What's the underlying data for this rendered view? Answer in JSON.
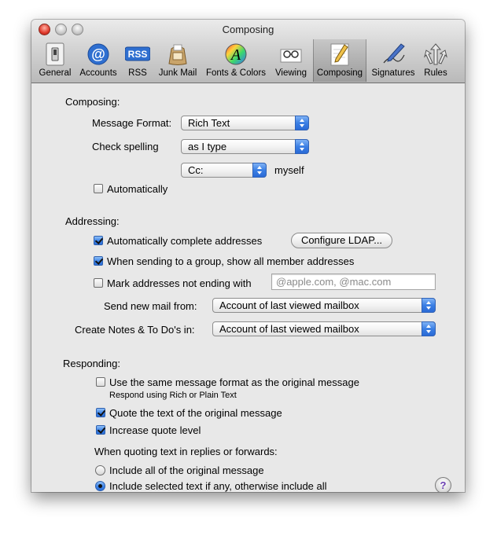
{
  "window": {
    "title": "Composing"
  },
  "toolbar": {
    "items": [
      {
        "label": "General",
        "icon": "general-switch-icon"
      },
      {
        "label": "Accounts",
        "icon": "at-sign-icon"
      },
      {
        "label": "RSS",
        "icon": "rss-icon",
        "badge": "RSS"
      },
      {
        "label": "Junk Mail",
        "icon": "junk-mail-bag-icon"
      },
      {
        "label": "Fonts & Colors",
        "icon": "fonts-colors-icon",
        "glyph": "A"
      },
      {
        "label": "Viewing",
        "icon": "viewing-glasses-icon"
      },
      {
        "label": "Composing",
        "icon": "composing-pencil-icon",
        "active": true
      },
      {
        "label": "Signatures",
        "icon": "signatures-pen-icon"
      },
      {
        "label": "Rules",
        "icon": "rules-arrows-icon"
      }
    ],
    "active_color": "#3c82e6"
  },
  "composing": {
    "heading": "Composing:",
    "message_format_label": "Message Format:",
    "message_format_value": "Rich Text",
    "check_spelling_label": "Check spelling",
    "check_spelling_value": "as I type",
    "automatically_label": "Automatically",
    "automatically_checked": false,
    "cc_value": "Cc:",
    "myself_label": "myself"
  },
  "addressing": {
    "heading": "Addressing:",
    "auto_complete_label": "Automatically complete addresses",
    "auto_complete_checked": true,
    "configure_ldap_label": "Configure LDAP...",
    "group_label": "When sending to a group, show all member addresses",
    "group_checked": true,
    "mark_addresses_label": "Mark addresses not ending with",
    "mark_addresses_checked": false,
    "mark_addresses_placeholder": "@apple.com, @mac.com",
    "send_from_label": "Send new mail from:",
    "send_from_value": "Account of last viewed mailbox",
    "notes_label": "Create Notes & To Do's in:",
    "notes_value": "Account of last viewed mailbox"
  },
  "responding": {
    "heading": "Responding:",
    "same_format_label": "Use the same message format as the original message",
    "same_format_checked": false,
    "same_format_hint": "Respond using Rich or Plain Text",
    "quote_text_label": "Quote the text of the original message",
    "quote_text_checked": true,
    "increase_quote_label": "Increase quote level",
    "increase_quote_checked": true,
    "quoting_heading": "When quoting text in replies or forwards:",
    "include_all_label": "Include all of the original message",
    "include_all_selected": false,
    "include_selected_label": "Include selected text if any, otherwise include all",
    "include_selected_selected": true
  },
  "help": {
    "glyph": "?"
  }
}
